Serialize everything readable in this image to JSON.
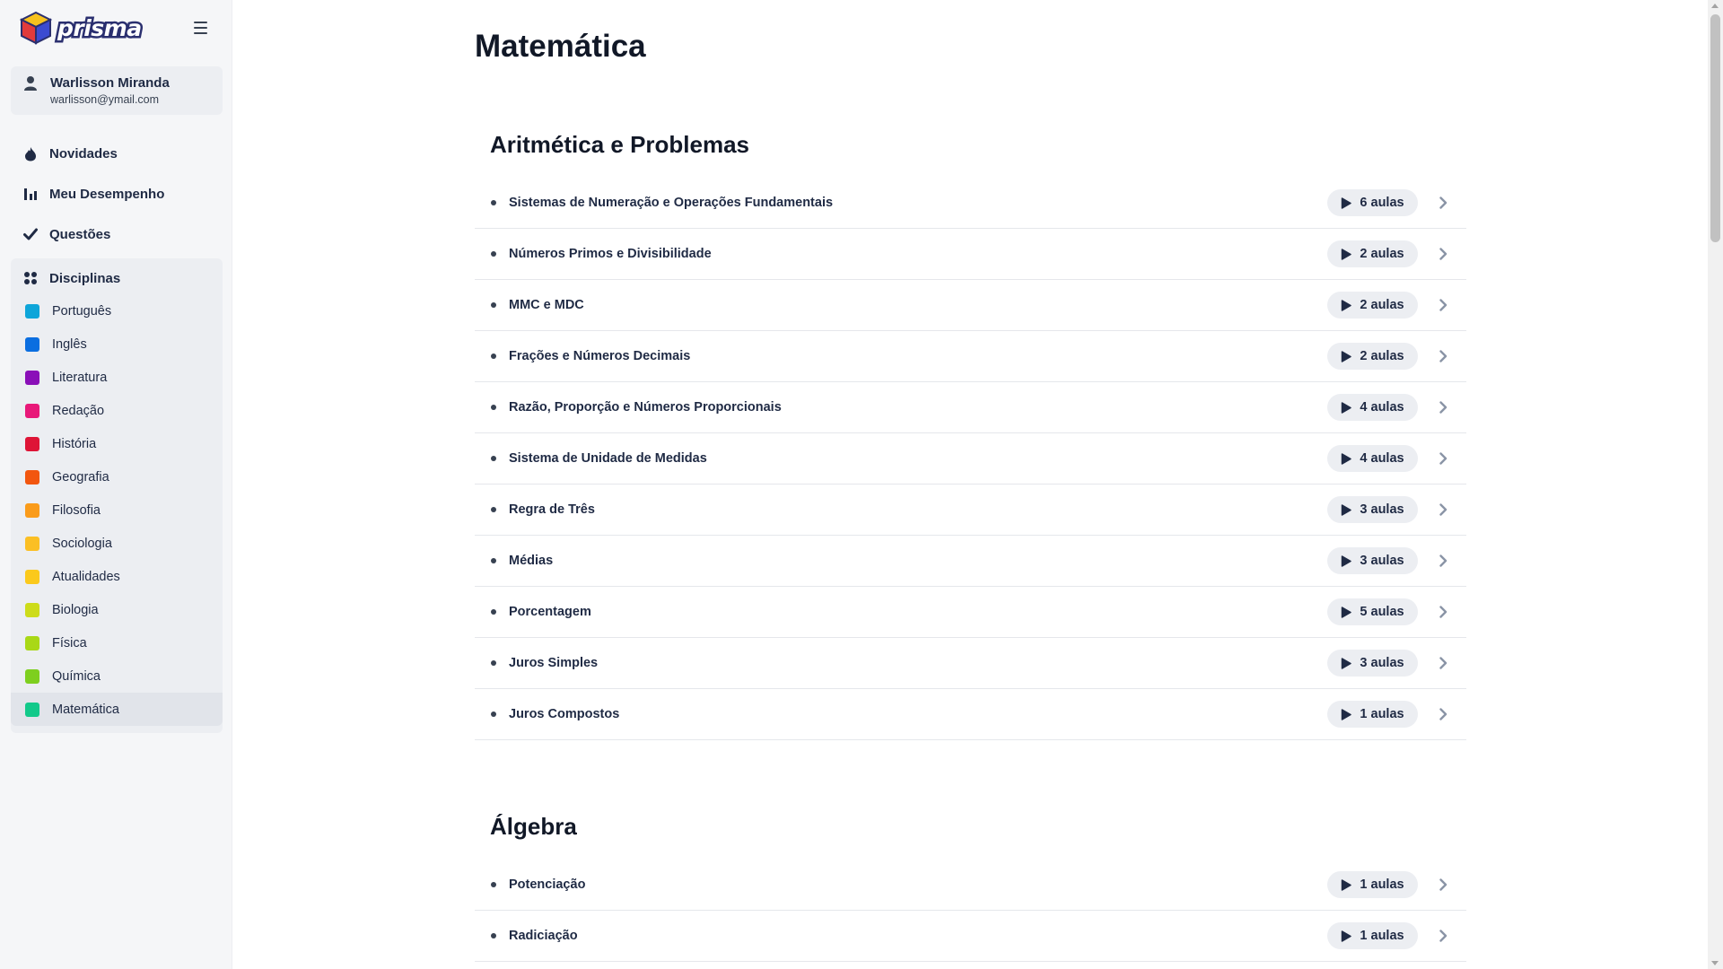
{
  "brand": {
    "name": "prisma",
    "icon": "cube-logo-icon"
  },
  "user": {
    "name": "Warlisson Miranda",
    "email": "warlisson@ymail.com",
    "icon": "user-icon"
  },
  "nav": [
    {
      "label": "Novidades",
      "icon": "flame-icon"
    },
    {
      "label": "Meu Desempenho",
      "icon": "bar-chart-icon"
    },
    {
      "label": "Questões",
      "icon": "check-icon"
    }
  ],
  "disciplinas": {
    "header": "Disciplinas",
    "icon": "grid-dots-icon",
    "items": [
      {
        "label": "Português",
        "color": "#0ea5d9"
      },
      {
        "label": "Inglês",
        "color": "#0b6ee0"
      },
      {
        "label": "Literatura",
        "color": "#8a0fb8"
      },
      {
        "label": "Redação",
        "color": "#e81879"
      },
      {
        "label": "História",
        "color": "#de1436"
      },
      {
        "label": "Geografia",
        "color": "#f2560f"
      },
      {
        "label": "Filosofia",
        "color": "#fa9b1a"
      },
      {
        "label": "Sociologia",
        "color": "#fbbf24"
      },
      {
        "label": "Atualidades",
        "color": "#fbc91c"
      },
      {
        "label": "Biologia",
        "color": "#cddc1a"
      },
      {
        "label": "Física",
        "color": "#a9d816"
      },
      {
        "label": "Química",
        "color": "#7ecf1f"
      },
      {
        "label": "Matemática",
        "color": "#12c98a",
        "active": true
      }
    ]
  },
  "page": {
    "title": "Matemática"
  },
  "sections": [
    {
      "title": "Aritmética e Problemas",
      "topics": [
        {
          "label": "Sistemas de Numeração e Operações Fundamentais",
          "lessons": "6 aulas"
        },
        {
          "label": "Números Primos e Divisibilidade",
          "lessons": "2 aulas"
        },
        {
          "label": "MMC e MDC",
          "lessons": "2 aulas"
        },
        {
          "label": "Frações e Números Decimais",
          "lessons": "2 aulas"
        },
        {
          "label": "Razão, Proporção e Números Proporcionais",
          "lessons": "4 aulas"
        },
        {
          "label": "Sistema de Unidade de Medidas",
          "lessons": "4 aulas"
        },
        {
          "label": "Regra de Três",
          "lessons": "3 aulas"
        },
        {
          "label": "Médias",
          "lessons": "3 aulas"
        },
        {
          "label": "Porcentagem",
          "lessons": "5 aulas"
        },
        {
          "label": "Juros Simples",
          "lessons": "3 aulas"
        },
        {
          "label": "Juros Compostos",
          "lessons": "1 aulas"
        }
      ]
    },
    {
      "title": "Álgebra",
      "topics": [
        {
          "label": "Potenciação",
          "lessons": "1 aulas"
        },
        {
          "label": "Radiciação",
          "lessons": "1 aulas"
        }
      ]
    }
  ],
  "icons": {
    "play": "play-icon",
    "chevron": "chevron-right-icon",
    "menu": "hamburger-menu-icon"
  }
}
